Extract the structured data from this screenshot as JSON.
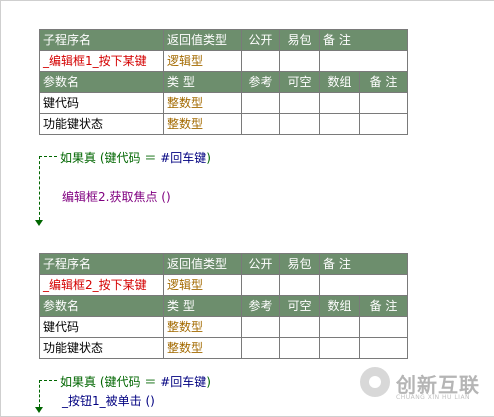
{
  "subs": [
    {
      "headers": [
        "子程序名",
        "返回值类型",
        "公开",
        "易包",
        "备 注"
      ],
      "row": {
        "name": "_编辑框1_按下某键",
        "type": "逻辑型"
      },
      "param_headers": [
        "参数名",
        "类 型",
        "参考",
        "可空",
        "数组",
        "备 注"
      ],
      "params": [
        {
          "name": "键代码",
          "type": "整数型"
        },
        {
          "name": "功能键状态",
          "type": "整数型"
        }
      ],
      "code": {
        "if_kw": "如果真",
        "cond_open": "(",
        "cond_var": "键代码",
        "cond_op": "＝",
        "cond_const": "#回车键",
        "cond_close": ")",
        "body": "编辑框2.获取焦点 ()"
      }
    },
    {
      "headers": [
        "子程序名",
        "返回值类型",
        "公开",
        "易包",
        "备 注"
      ],
      "row": {
        "name": "_编辑框2_按下某键",
        "type": "逻辑型"
      },
      "param_headers": [
        "参数名",
        "类 型",
        "参考",
        "可空",
        "数组",
        "备 注"
      ],
      "params": [
        {
          "name": "键代码",
          "type": "整数型"
        },
        {
          "name": "功能键状态",
          "type": "整数型"
        }
      ],
      "code": {
        "if_kw": "如果真",
        "cond_open": "(",
        "cond_var": "键代码",
        "cond_op": "＝",
        "cond_const": "#回车键",
        "cond_close": ")",
        "body": "_按钮1_被单击 ()"
      }
    }
  ],
  "watermark": {
    "text": "创新互联",
    "sub": "CHUANG XIN HU LIAN"
  },
  "colors": {
    "header_bg": "#6d8e6d",
    "sub_name": "#d40000",
    "type_text": "#a36a00",
    "keyword": "#006600"
  }
}
